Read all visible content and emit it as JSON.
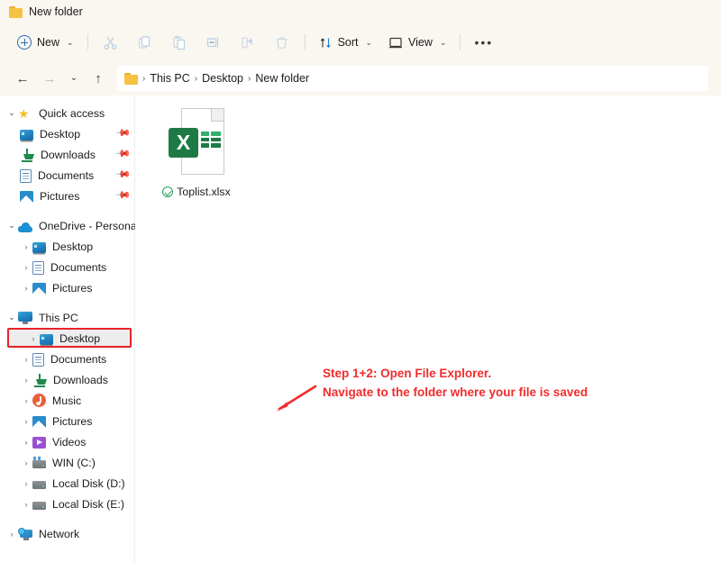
{
  "titlebar": {
    "tab_label": "New folder",
    "folder_icon": "folder-icon"
  },
  "toolbar": {
    "new_label": "New",
    "new_chevron": "⌄",
    "cut_icon": "cut-icon",
    "copy_icon": "copy-icon",
    "paste_icon": "paste-icon",
    "rename_icon": "rename-icon",
    "share_icon": "share-icon",
    "delete_icon": "delete-icon",
    "sort_label": "Sort",
    "sort_chevron": "⌄",
    "view_label": "View",
    "view_chevron": "⌄",
    "more_label": "•••"
  },
  "addressbar": {
    "back_icon": "←",
    "forward_icon": "→",
    "recent_icon": "⌄",
    "up_icon": "↑",
    "folder_icon": "folder-icon",
    "separator": "›",
    "crumbs": [
      "This PC",
      "Desktop",
      "New folder"
    ]
  },
  "sidebar": {
    "sections": [
      {
        "name": "Quick access",
        "icon": "star-icon",
        "twisty": "⌄",
        "items": [
          {
            "label": "Desktop",
            "icon": "desktop-icon",
            "pinned": true
          },
          {
            "label": "Downloads",
            "icon": "downloads-icon",
            "pinned": true
          },
          {
            "label": "Documents",
            "icon": "documents-icon",
            "pinned": true
          },
          {
            "label": "Pictures",
            "icon": "pictures-icon",
            "pinned": true
          }
        ]
      },
      {
        "name": "OneDrive - Personal",
        "icon": "cloud-icon",
        "twisty": "⌄",
        "items": [
          {
            "label": "Desktop",
            "icon": "desktop-icon",
            "twisty": "›"
          },
          {
            "label": "Documents",
            "icon": "documents-icon",
            "twisty": "›"
          },
          {
            "label": "Pictures",
            "icon": "pictures-icon",
            "twisty": "›"
          }
        ]
      },
      {
        "name": "This PC",
        "icon": "this-pc-icon",
        "twisty": "⌄",
        "items": [
          {
            "label": "Desktop",
            "icon": "desktop-icon",
            "twisty": "›",
            "selected": true
          },
          {
            "label": "Documents",
            "icon": "documents-icon",
            "twisty": "›"
          },
          {
            "label": "Downloads",
            "icon": "downloads-icon",
            "twisty": "›"
          },
          {
            "label": "Music",
            "icon": "music-icon",
            "twisty": "›"
          },
          {
            "label": "Pictures",
            "icon": "pictures-icon",
            "twisty": "›"
          },
          {
            "label": "Videos",
            "icon": "videos-icon",
            "twisty": "›"
          },
          {
            "label": "WIN (C:)",
            "icon": "windows-drive-icon",
            "twisty": "›"
          },
          {
            "label": "Local Disk (D:)",
            "icon": "drive-icon",
            "twisty": "›"
          },
          {
            "label": "Local Disk (E:)",
            "icon": "drive-icon",
            "twisty": "›"
          }
        ]
      },
      {
        "name": "Network",
        "icon": "network-icon",
        "twisty": "›",
        "items": []
      }
    ]
  },
  "content": {
    "files": [
      {
        "name": "Toplist.xlsx",
        "icon": "excel-file-icon",
        "badge_letter": "X",
        "sync_status": "synced-check-icon"
      }
    ]
  },
  "annotation": {
    "line1": "Step 1+2: Open File Explorer.",
    "line2": "Navigate to the folder where your file is saved",
    "arrow": "arrow-pointing-down-left",
    "color": "#f12c2c",
    "highlight_target": "This PC > Desktop",
    "highlight_color": "#e8232a"
  }
}
